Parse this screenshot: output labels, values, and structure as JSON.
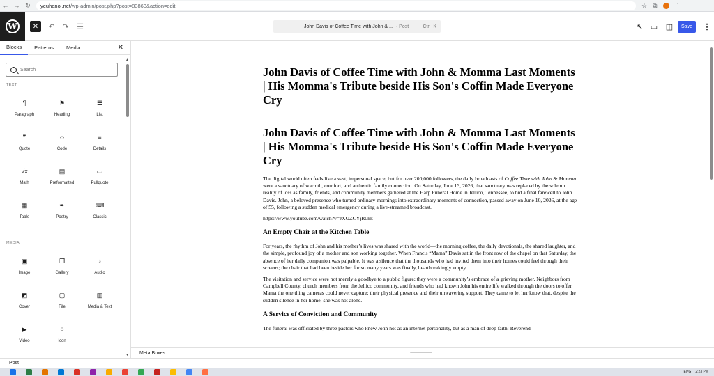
{
  "browser": {
    "url_host": "yeuhanoi.net",
    "url_path": "/wp-admin/post.php?post=83863&action=edit"
  },
  "toolbar": {
    "command_title": "John Davis of Coffee Time with John & ...",
    "command_type": "· Post",
    "command_shortcut": "Ctrl+K",
    "save_label": "Save"
  },
  "sidebar": {
    "tabs": [
      {
        "label": "Blocks"
      },
      {
        "label": "Patterns"
      },
      {
        "label": "Media"
      }
    ],
    "search_placeholder": "Search",
    "categories": [
      {
        "label": "TEXT",
        "blocks": [
          {
            "label": "Paragraph",
            "icon": "¶"
          },
          {
            "label": "Heading",
            "icon": "⚑"
          },
          {
            "label": "List",
            "icon": "☰"
          },
          {
            "label": "Quote",
            "icon": "❞"
          },
          {
            "label": "Code",
            "icon": "‹›"
          },
          {
            "label": "Details",
            "icon": "≡"
          },
          {
            "label": "Math",
            "icon": "√x"
          },
          {
            "label": "Preformatted",
            "icon": "▤"
          },
          {
            "label": "Pullquote",
            "icon": "▭"
          },
          {
            "label": "Table",
            "icon": "▦"
          },
          {
            "label": "Poetry",
            "icon": "✒"
          },
          {
            "label": "Classic",
            "icon": "⌨"
          }
        ]
      },
      {
        "label": "MEDIA",
        "blocks": [
          {
            "label": "Image",
            "icon": "▣"
          },
          {
            "label": "Gallery",
            "icon": "❐"
          },
          {
            "label": "Audio",
            "icon": "♪"
          },
          {
            "label": "Cover",
            "icon": "◩"
          },
          {
            "label": "File",
            "icon": "▢"
          },
          {
            "label": "Media & Text",
            "icon": "▥"
          },
          {
            "label": "Video",
            "icon": "▶"
          },
          {
            "label": "Icon",
            "icon": "⁘"
          }
        ]
      }
    ]
  },
  "document": {
    "title": "John Davis of Coffee Time with John & Momma Last Moments | His Momma's Tribute beside His Son's Coffin Made Everyone Cry",
    "heading": "John Davis of Coffee Time with John & Momma Last Moments | His Momma's Tribute beside His Son's Coffin Made Everyone Cry",
    "p1_before": "The digital world often feels like a vast, impersonal space, but for over 200,000 followers, the daily broadcasts of ",
    "p1_em": "Coffee Time with John & Momma",
    "p1_after": " were a sanctuary of warmth, comfort, and authentic family connection. On Saturday, June 13, 2026, that sanctuary was replaced by the solemn reality of loss as family, friends, and community members gathered at the Harp Funeral Home in Jellico, Tennessee, to bid a final farewell to John Davis. John, a beloved presence who turned ordinary mornings into extraordinary moments of connection, passed away on June 10, 2026, at the age of 55, following a sudden medical emergency during a live-streamed broadcast.",
    "video_url": "https://www.youtube.com/watch?v=JXUZCYjR0kk",
    "h2_1": "An Empty Chair at the Kitchen Table",
    "p2": "For years, the rhythm of John and his mother’s lives was shared with the world—the morning coffee, the daily devotionals, the shared laughter, and the simple, profound joy of a mother and son working together. When Francis “Mama” Davis sat in the front row of the chapel on that Saturday, the absence of her daily companion was palpable. It was a silence that the thousands who had invited them into their homes could feel through their screens; the chair that had been beside her for so many years was finally, heartbreakingly empty.",
    "p3": "The visitation and service were not merely a goodbye to a public figure; they were a community’s embrace of a grieving mother. Neighbors from Campbell County, church members from the Jellico community, and friends who had known John his entire life walked through the doors to offer Mama the one thing cameras could never capture: their physical presence and their unwavering support. They came to let her know that, despite the sudden silence in her home, she was not alone.",
    "h2_2": "A Service of Conviction and Community",
    "p4": "The funeral was officiated by three pastors who knew John not as an internet personality, but as a man of deep faith: Reverend"
  },
  "meta_boxes_label": "Meta Boxes",
  "breadcrumb": "Post",
  "taskbar": {
    "time": "2:23 PM",
    "lang": "ENG",
    "app_colors": [
      "#1a73e8",
      "#2d7d46",
      "#e37400",
      "#0078d4",
      "#d93025",
      "#8e24aa",
      "#f9ab00",
      "#ea4335",
      "#34a853",
      "#c5221f",
      "#fbbc04",
      "#4285f4",
      "#ff7043"
    ]
  }
}
